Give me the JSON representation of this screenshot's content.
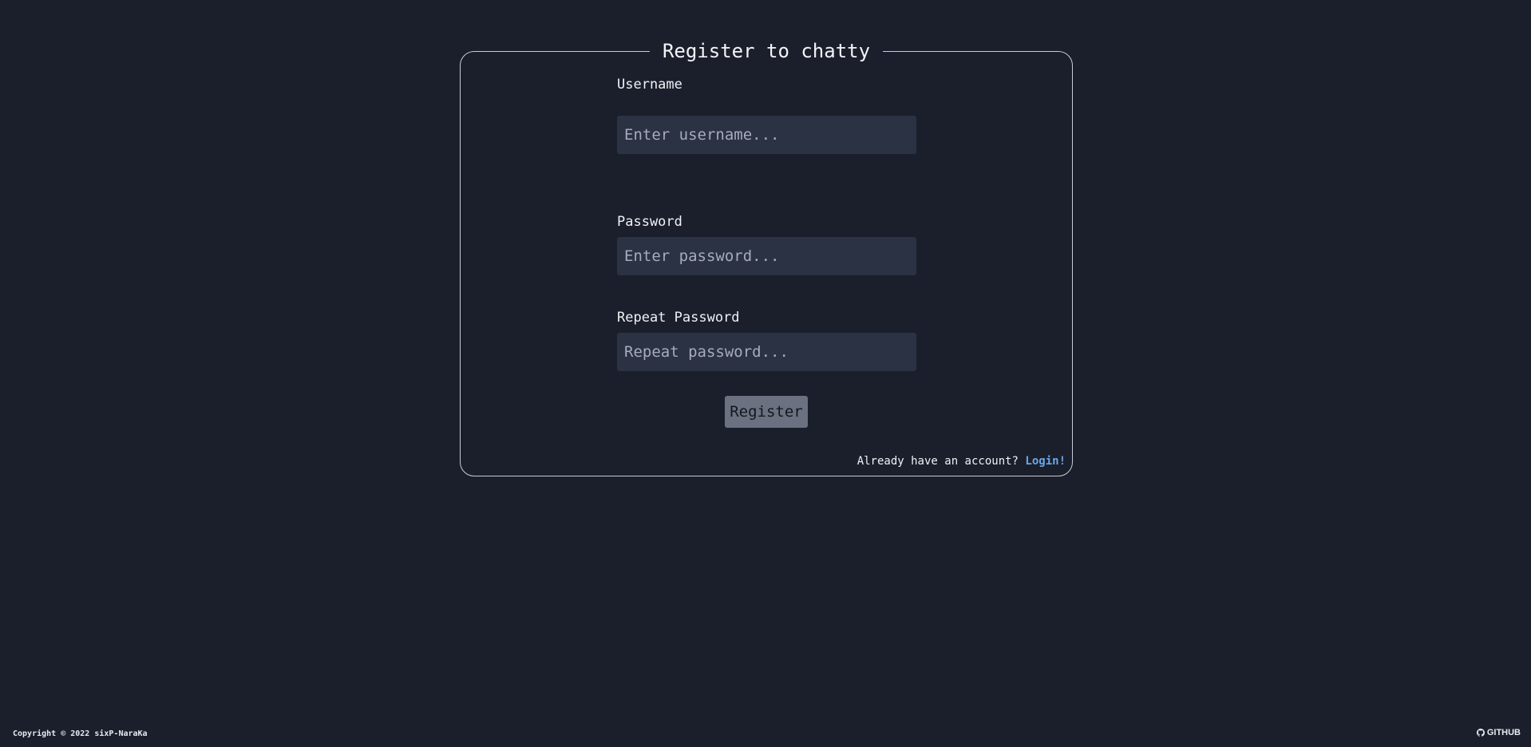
{
  "form": {
    "title": "Register to chatty",
    "username": {
      "label": "Username",
      "placeholder": "Enter username...",
      "value": ""
    },
    "password": {
      "label": "Password",
      "placeholder": "Enter password...",
      "value": ""
    },
    "repeat_password": {
      "label": "Repeat Password",
      "placeholder": "Repeat password...",
      "value": ""
    },
    "submit_label": "Register",
    "account_prompt": "Already have an account?",
    "login_label": "Login!"
  },
  "footer": {
    "copyright": "Copyright © 2022 sixP-NaraKa",
    "github_label": "GITHUB",
    "github_icon": "github-icon"
  },
  "colors": {
    "background": "#1b1f2c",
    "input_background": "#2b3244",
    "button_background": "#6b7180",
    "link": "#6aa8e6",
    "border": "#c8ccd6"
  }
}
